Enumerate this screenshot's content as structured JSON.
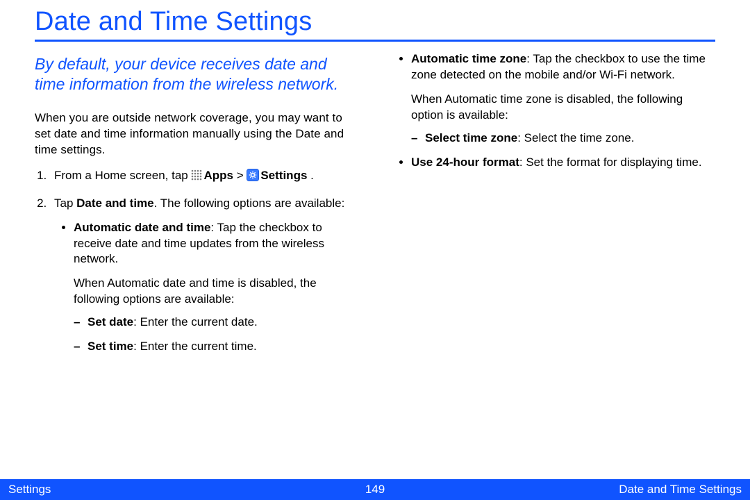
{
  "title": "Date and Time Settings",
  "intro": "By default, your device receives date and time information from the wireless network.",
  "col1": {
    "para1": "When you are outside network coverage, you may want to set date and time information manually using the Date and time settings.",
    "step1_a": "From a Home screen, tap ",
    "step1_apps": "Apps",
    "step1_b": " > ",
    "step1_settings": "Settings",
    "step1_c": " .",
    "step2_a": "Tap ",
    "step2_bold": "Date and time",
    "step2_b": ". The following options are available:",
    "bullet1_bold": "Automatic date and time",
    "bullet1_rest": ": Tap the checkbox to receive date and time updates from the wireless network.",
    "bullet1_sub": "When Automatic date and time is disabled, the following options are available:",
    "dash1_bold": "Set date",
    "dash1_rest": ": Enter the current date.",
    "dash2_bold": "Set time",
    "dash2_rest": ": Enter the current time."
  },
  "col2": {
    "bullet1_bold": "Automatic time zone",
    "bullet1_rest": ": Tap the checkbox to use the time zone detected on the mobile and/or Wi-Fi network.",
    "bullet1_sub": "When Automatic time zone is disabled, the following option is available:",
    "dash1_bold": "Select time zone",
    "dash1_rest": ": Select the time zone.",
    "bullet2_bold": "Use 24-hour format",
    "bullet2_rest": ": Set the format for displaying time."
  },
  "footer": {
    "left": "Settings",
    "center": "149",
    "right": "Date and Time Settings"
  }
}
